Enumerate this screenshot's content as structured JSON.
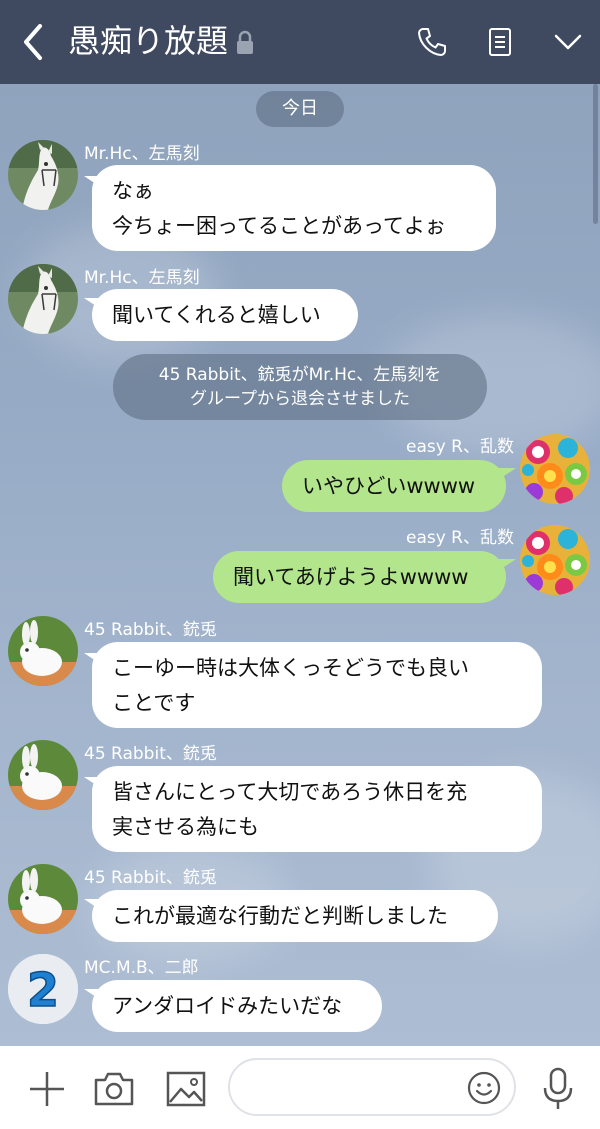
{
  "header": {
    "title": "愚痴り放題",
    "bg_color": "#3f4a60",
    "icons": [
      "back-chevron-icon",
      "lock-icon",
      "phone-icon",
      "notes-icon",
      "chevron-down-icon"
    ]
  },
  "chat": {
    "date_label": "今日",
    "system_message": "45 Rabbit、銃兎がMr.Hc、左馬刻を\nグループから退会させました",
    "messages": [
      {
        "sender": "Mr.Hc、左馬刻",
        "text": "なぁ\n今ちょー困ってることがあってよぉ",
        "side": "in",
        "avatar": "white-horse"
      },
      {
        "sender": "Mr.Hc、左馬刻",
        "text": "聞いてくれると嬉しい",
        "side": "in",
        "avatar": "white-horse"
      },
      {
        "sender": "easy R、乱数",
        "text": "いやひどいwwww",
        "side": "out",
        "avatar": "candy"
      },
      {
        "sender": "easy R、乱数",
        "text": "聞いてあげようよwwww",
        "side": "out",
        "avatar": "candy"
      },
      {
        "sender": "45 Rabbit、銃兎",
        "text": "こーゆー時は大体くっそどうでも良い\nことです",
        "side": "in",
        "avatar": "white-rabbit"
      },
      {
        "sender": "45 Rabbit、銃兎",
        "text": "皆さんにとって大切であろう休日を充\n実させる為にも",
        "side": "in",
        "avatar": "white-rabbit"
      },
      {
        "sender": "45 Rabbit、銃兎",
        "text": "これが最適な行動だと判断しました",
        "side": "in",
        "avatar": "white-rabbit"
      },
      {
        "sender": "MC.M.B、二郎",
        "text": "アンダロイドみたいだな",
        "side": "in",
        "avatar": "blue-number-2",
        "avatar_text": "2"
      }
    ],
    "colors": {
      "incoming_bubble": "#ffffff",
      "outgoing_bubble": "#b3e58c"
    }
  },
  "footer": {
    "icons": [
      "plus-icon",
      "camera-icon",
      "image-icon",
      "emoji-icon",
      "microphone-icon"
    ],
    "input_placeholder": ""
  }
}
